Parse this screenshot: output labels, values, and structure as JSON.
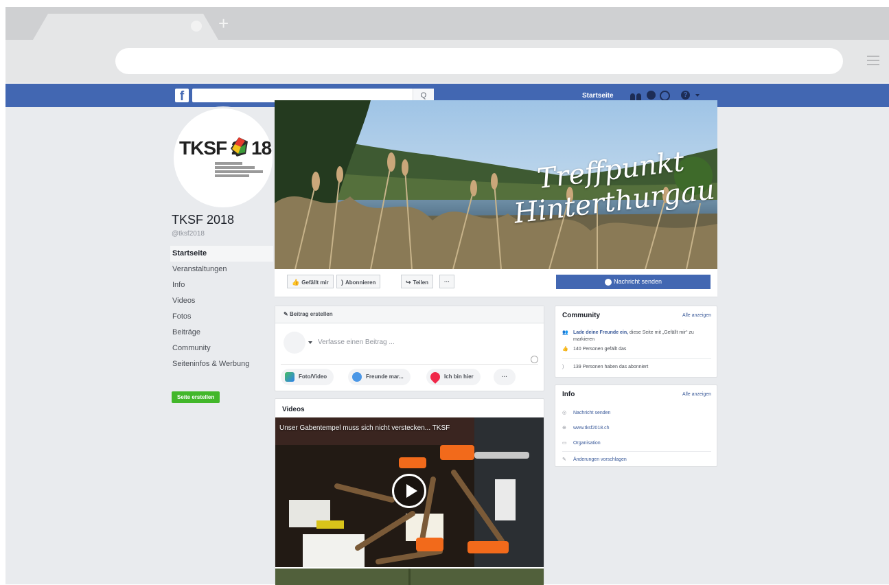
{
  "browser": {
    "new_tab_symbol": "+"
  },
  "topbar": {
    "logo": "f",
    "search_placeholder": "",
    "search_button": "Q",
    "home_label": "Startseite",
    "help_symbol": "?"
  },
  "page": {
    "name": "TKSF 2018",
    "handle": "@tksf2018",
    "logo_text_a": "TKSF 2",
    "logo_text_b": "18"
  },
  "left_nav": {
    "items": [
      {
        "label": "Startseite",
        "active": true
      },
      {
        "label": "Veranstaltungen"
      },
      {
        "label": "Info"
      },
      {
        "label": "Videos"
      },
      {
        "label": "Fotos"
      },
      {
        "label": "Beiträge"
      },
      {
        "label": "Community"
      },
      {
        "label": "Seiteninfos & Werbung"
      }
    ],
    "create_page_label": "Seite erstellen"
  },
  "cover": {
    "line1": "Treffpunkt",
    "line2": "Hinterthurgau"
  },
  "actions": {
    "like": "Gefällt mir",
    "follow": "Abonnieren",
    "share": "Teilen",
    "more": "···",
    "send_message": "Nachricht senden"
  },
  "composer": {
    "title": "Beitrag erstellen",
    "placeholder": "Verfasse einen Beitrag ...",
    "buttons": {
      "photo": "Foto/Video",
      "tag": "Freunde mar...",
      "checkin": "Ich bin hier",
      "more": "···"
    }
  },
  "videos": {
    "title": "Videos",
    "video_title": "Unser Gabentempel muss sich nicht verstecken... TKSF"
  },
  "community": {
    "title": "Community",
    "see_all": "Alle anzeigen",
    "invite_link": "Lade deine Freunde ein,",
    "invite_rest": " diese Seite mit „Gefällt mir“ zu markieren",
    "likes": "140 Personen gefällt das",
    "follows": "139 Personen haben das abonniert"
  },
  "info": {
    "title": "Info",
    "see_all": "Alle anzeigen",
    "send_message": "Nachricht senden",
    "website": "www.tksf2018.ch",
    "category": "Organisation",
    "suggest": "Änderungen vorschlagen"
  },
  "colors": {
    "fb_blue": "#4267b2",
    "page_bg": "#e9ebee",
    "link": "#385898",
    "green": "#42b72a"
  }
}
